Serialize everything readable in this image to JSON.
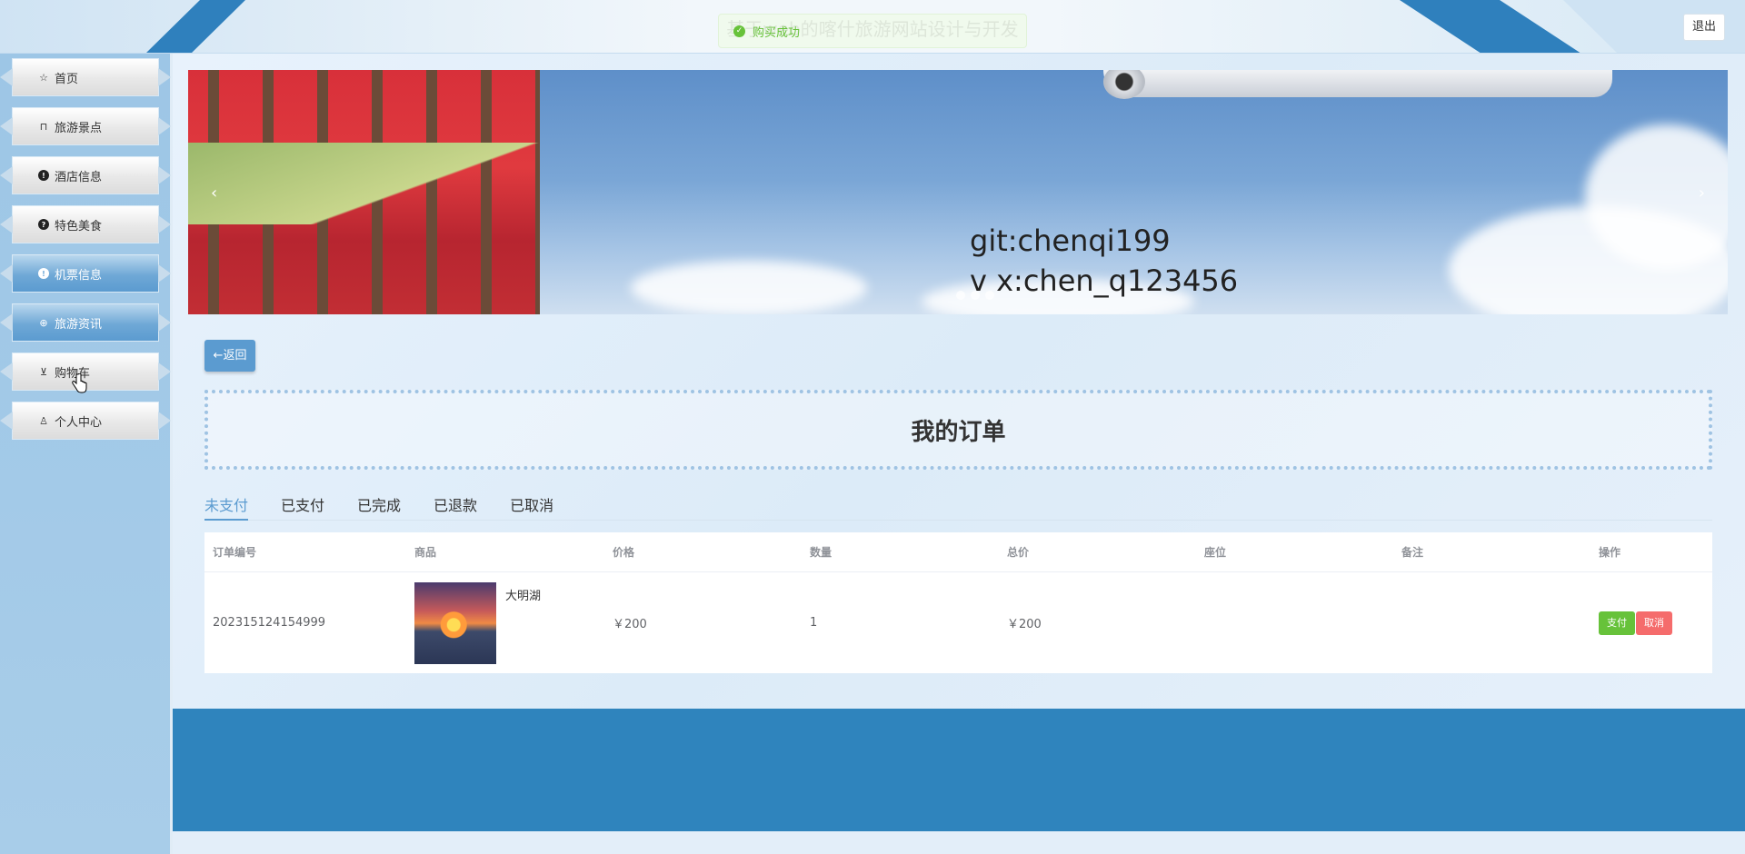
{
  "header": {
    "title": "基于web的喀什旅游网站设计与开发",
    "logout_label": "退出",
    "toast": "购买成功"
  },
  "sidebar": {
    "items": [
      {
        "label": "首页",
        "icon": "star-icon"
      },
      {
        "label": "旅游景点",
        "icon": "bag-icon"
      },
      {
        "label": "酒店信息",
        "icon": "info-icon"
      },
      {
        "label": "特色美食",
        "icon": "question-icon"
      },
      {
        "label": "机票信息",
        "icon": "info-icon"
      },
      {
        "label": "旅游资讯",
        "icon": "globe-icon"
      },
      {
        "label": "购物车",
        "icon": "cart-icon"
      },
      {
        "label": "个人中心",
        "icon": "user-icon"
      }
    ]
  },
  "banner": {
    "line1": "git:chenqi199",
    "line2": "v x:chen_q123456"
  },
  "main": {
    "back_label": "←返回",
    "page_title": "我的订单",
    "tabs": [
      "未支付",
      "已支付",
      "已完成",
      "已退款",
      "已取消"
    ],
    "active_tab": "未支付"
  },
  "table": {
    "columns": [
      "订单编号",
      "商品",
      "价格",
      "数量",
      "总价",
      "座位",
      "备注",
      "操作"
    ],
    "rows": [
      {
        "order_no": "202315124154999",
        "product": "大明湖",
        "price": "￥200",
        "qty": "1",
        "total": "￥200",
        "seat": "",
        "note": "",
        "pay_label": "支付",
        "cancel_label": "取消"
      }
    ]
  },
  "colors": {
    "accent": "#5b9bd0",
    "footer": "#2f84bd",
    "pay": "#67c23a",
    "cancel": "#f56c6c"
  }
}
